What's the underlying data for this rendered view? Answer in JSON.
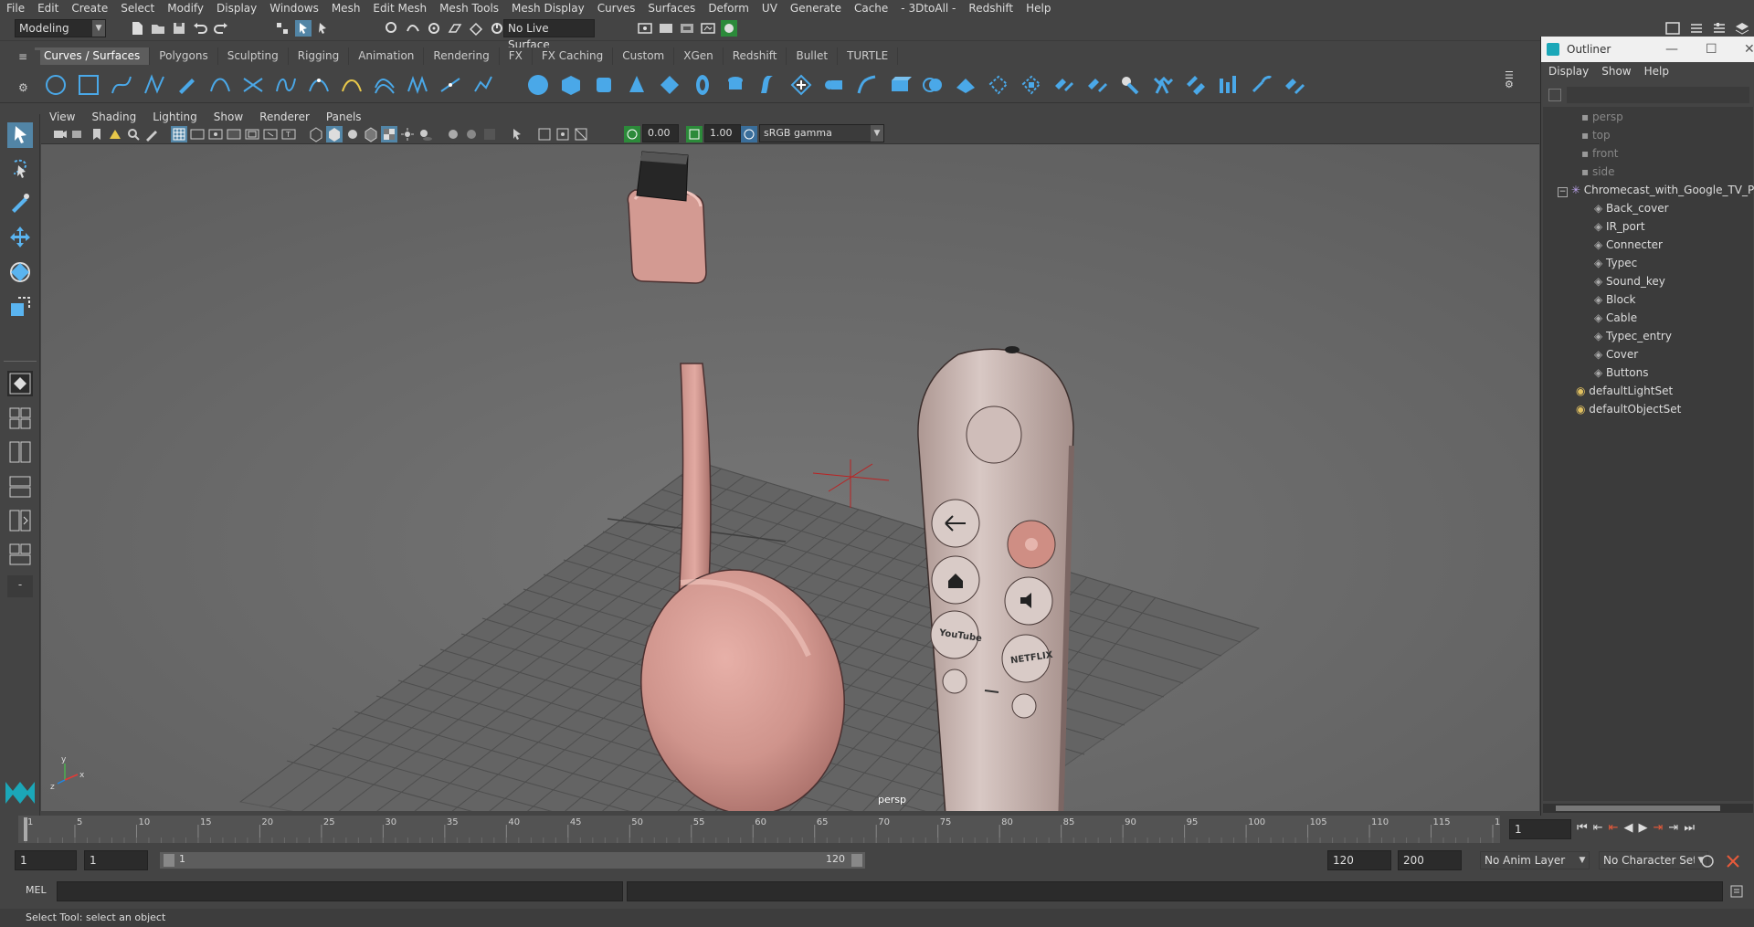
{
  "menubar": {
    "items": [
      "File",
      "Edit",
      "Create",
      "Select",
      "Modify",
      "Display",
      "Windows",
      "Mesh",
      "Edit Mesh",
      "Mesh Tools",
      "Mesh Display",
      "Curves",
      "Surfaces",
      "Deform",
      "UV",
      "Generate",
      "Cache",
      "- 3DtoAll -",
      "Redshift",
      "Help"
    ]
  },
  "statusline": {
    "mode": "Modeling",
    "live_surface": "No Live Surface"
  },
  "shelf": {
    "tabs": [
      "Curves / Surfaces",
      "Polygons",
      "Sculpting",
      "Rigging",
      "Animation",
      "Rendering",
      "FX",
      "FX Caching",
      "Custom",
      "XGen",
      "Redshift",
      "Bullet",
      "TURTLE"
    ],
    "active_tab": "Curves / Surfaces"
  },
  "viewport": {
    "menu": [
      "View",
      "Shading",
      "Lighting",
      "Show",
      "Renderer",
      "Panels"
    ],
    "exposure": "0.00",
    "gamma": "1.00",
    "color_space": "sRGB gamma",
    "camera_label": "persp"
  },
  "outliner": {
    "title": "Outliner",
    "menus": [
      "Display",
      "Show",
      "Help"
    ],
    "cameras": [
      "persp",
      "top",
      "front",
      "side"
    ],
    "root": "Chromecast_with_Google_TV_Pink",
    "children": [
      "Back_cover",
      "IR_port",
      "Connecter",
      "Typec",
      "Sound_key",
      "Block",
      "Cable",
      "Typec_entry",
      "Cover",
      "Buttons"
    ],
    "sets": [
      "defaultLightSet",
      "defaultObjectSet"
    ]
  },
  "timeline": {
    "ticks": [
      "1",
      "5",
      "10",
      "15",
      "20",
      "25",
      "30",
      "35",
      "40",
      "45",
      "50",
      "55",
      "60",
      "65",
      "70",
      "75",
      "80",
      "85",
      "90",
      "95",
      "100",
      "105",
      "110",
      "115",
      "120"
    ],
    "current_frame": "1",
    "range_start": "1",
    "playback_start": "1",
    "range_slider_start": "1",
    "range_slider_end": "120",
    "playback_end": "120",
    "range_end": "200",
    "anim_layer": "No Anim Layer",
    "character_set": "No Character Set"
  },
  "cmdline": {
    "label": "MEL"
  },
  "helpline": {
    "text": "Select Tool: select an object"
  }
}
